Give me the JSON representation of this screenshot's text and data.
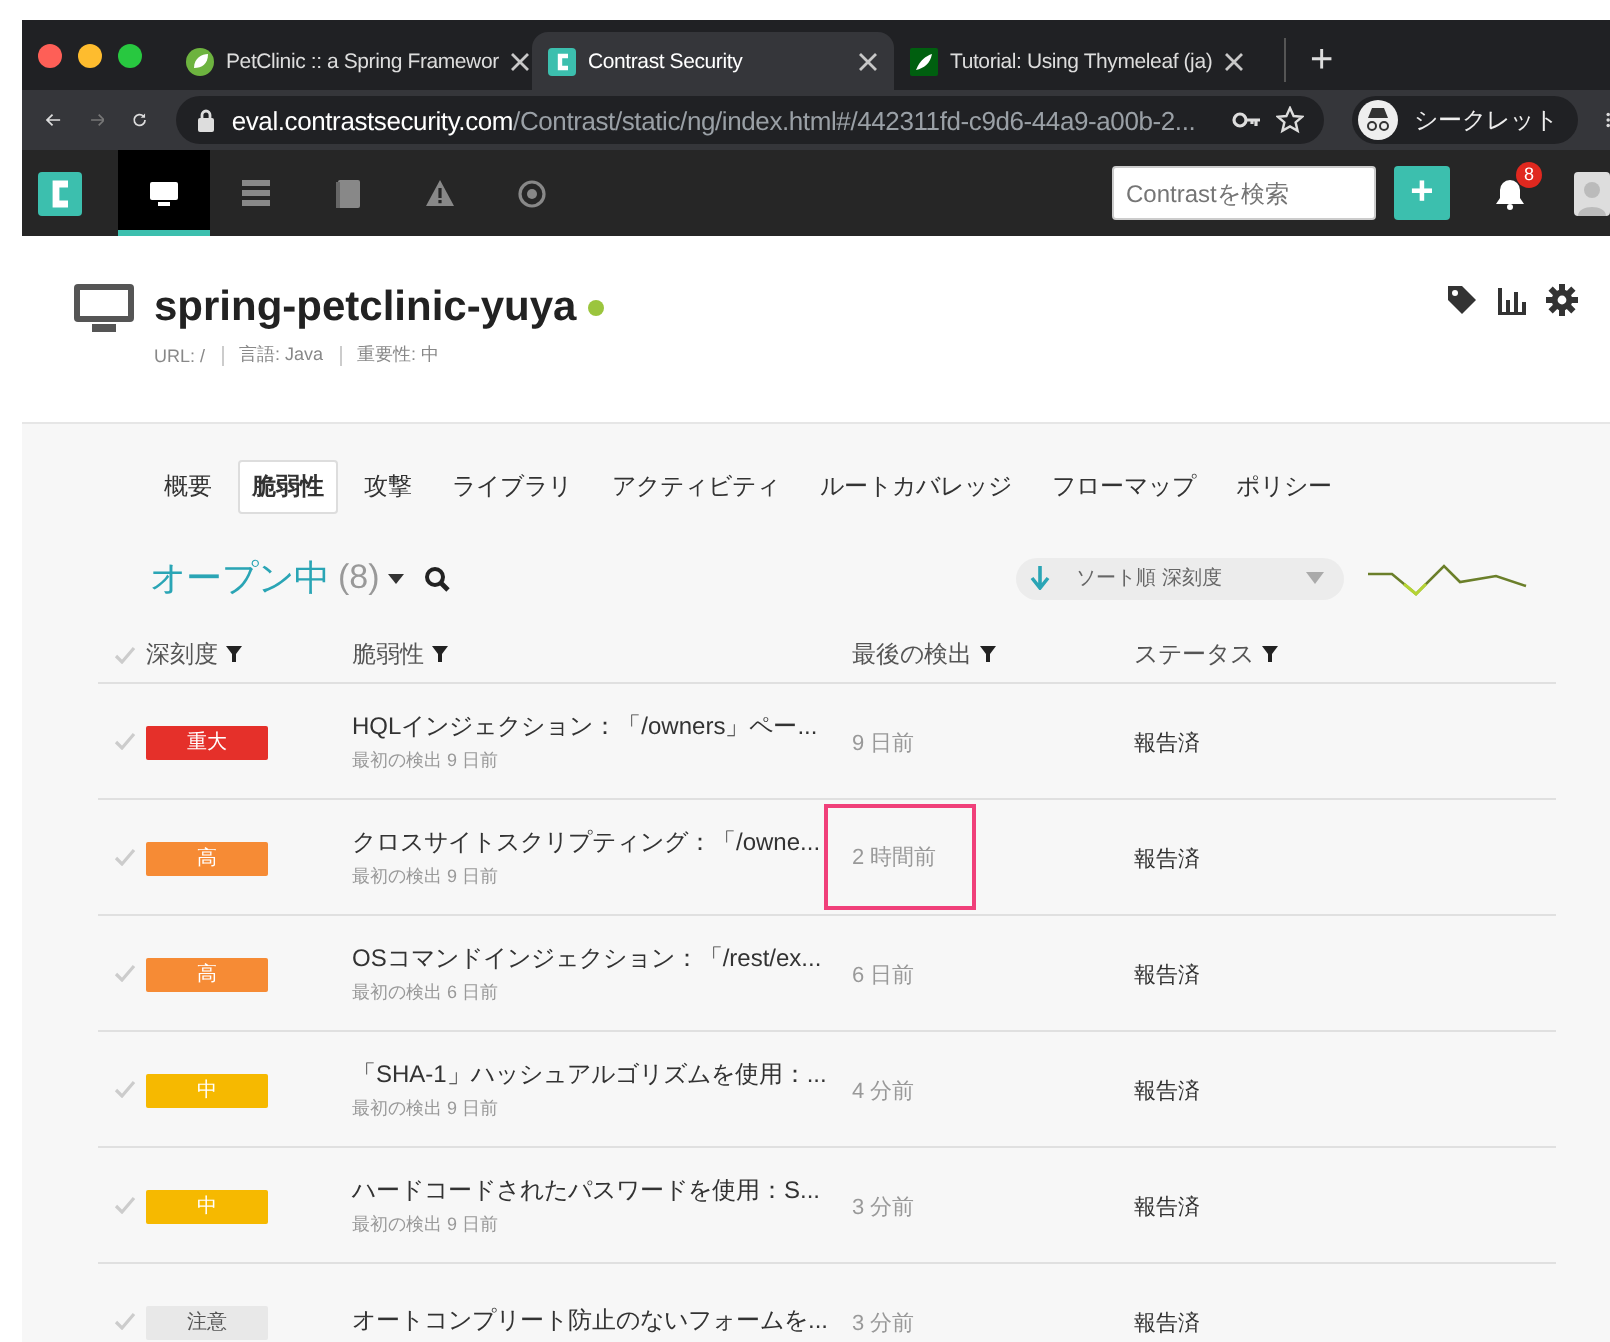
{
  "browser": {
    "tabs": [
      {
        "title": "PetClinic :: a Spring Framewor",
        "selected": false
      },
      {
        "title": "Contrast Security",
        "selected": true
      },
      {
        "title": "Tutorial: Using Thymeleaf (ja)",
        "selected": false
      }
    ],
    "new_tab": "+",
    "url_host": "eval.contrastsecurity.com",
    "url_path": "/Contrast/static/ng/index.html#/442311fd-c9d6-44a9-a00b-2...",
    "profile": "シークレット"
  },
  "app_nav": {
    "items": [
      {
        "selected": true
      },
      {
        "selected": false
      },
      {
        "selected": false
      },
      {
        "selected": false
      },
      {
        "selected": false
      }
    ],
    "search": {
      "placeholder": "Contrastを検索"
    },
    "add": "+",
    "notifications": "8"
  },
  "application": {
    "name": "spring-petclinic-yuya",
    "online": true,
    "meta": [
      "URL: /",
      "言語: Java",
      "重要性: 中"
    ]
  },
  "tabs": [
    {
      "label": "概要",
      "selected": false
    },
    {
      "label": "脆弱性",
      "selected": true
    },
    {
      "label": "攻撃",
      "selected": false
    },
    {
      "label": "ライブラリ",
      "selected": false
    },
    {
      "label": "アクティビティ",
      "selected": false
    },
    {
      "label": "ルートカバレッジ",
      "selected": false
    },
    {
      "label": "フローマップ",
      "selected": false
    },
    {
      "label": "ポリシー",
      "selected": false
    }
  ],
  "filter": {
    "title": "オープン中",
    "count": "(8)",
    "sort": "ソート順 深刻度"
  },
  "table": {
    "columns": [
      "深刻度",
      "脆弱性",
      "最後の検出",
      "ステータス"
    ],
    "rows": [
      {
        "severity": "重大",
        "kind": "critical",
        "title": "HQLインジェクション：「/owners」ペー...",
        "first_seen": "最初の検出 9 日前",
        "last_seen": "9 日前",
        "status": "報告済",
        "highlighted": false
      },
      {
        "severity": "高",
        "kind": "high",
        "title": "クロスサイトスクリプティング：「/owne...",
        "first_seen": "最初の検出 9 日前",
        "last_seen": "2 時間前",
        "status": "報告済",
        "highlighted": true
      },
      {
        "severity": "高",
        "kind": "high",
        "title": "OSコマンドインジェクション：「/rest/ex...",
        "first_seen": "最初の検出 6 日前",
        "last_seen": "6 日前",
        "status": "報告済",
        "highlighted": false
      },
      {
        "severity": "中",
        "kind": "medium",
        "title": "「SHA-1」ハッシュアルゴリズムを使用：...",
        "first_seen": "最初の検出 9 日前",
        "last_seen": "4 分前",
        "status": "報告済",
        "highlighted": false
      },
      {
        "severity": "中",
        "kind": "medium",
        "title": "ハードコードされたパスワードを使用：S...",
        "first_seen": "最初の検出 9 日前",
        "last_seen": "3 分前",
        "status": "報告済",
        "highlighted": false
      },
      {
        "severity": "注意",
        "kind": "note",
        "title": "オートコンプリート防止のないフォームを...",
        "last_seen": "3 分前",
        "status": "報告済",
        "highlighted": false
      }
    ]
  }
}
